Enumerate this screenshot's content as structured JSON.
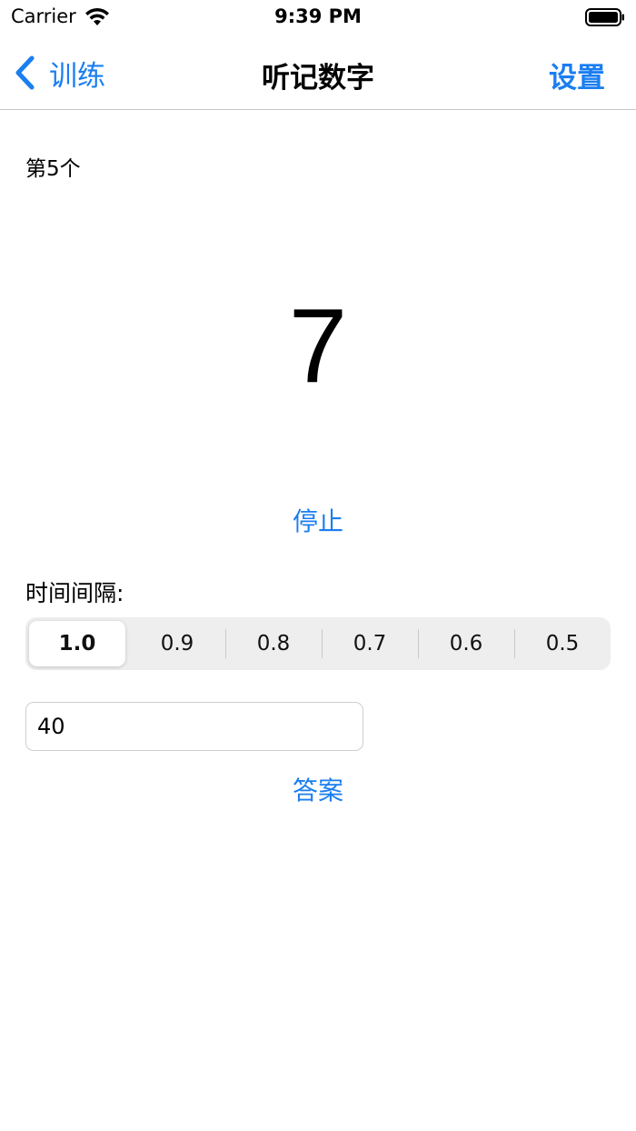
{
  "status_bar": {
    "carrier": "Carrier",
    "time": "9:39 PM"
  },
  "nav": {
    "back_label": "训练",
    "title": "听记数字",
    "settings_label": "设置"
  },
  "counter_text": "第5个",
  "current_digit": "7",
  "stop_label": "停止",
  "interval": {
    "label": "时间间隔:",
    "options": [
      "1.0",
      "0.9",
      "0.8",
      "0.7",
      "0.6",
      "0.5"
    ],
    "selected": "1.0"
  },
  "answer_input": {
    "value": "40",
    "placeholder": ""
  },
  "answer_label": "答案",
  "colors": {
    "accent": "#1a7ef0",
    "segment_bg": "#eeeeef"
  }
}
